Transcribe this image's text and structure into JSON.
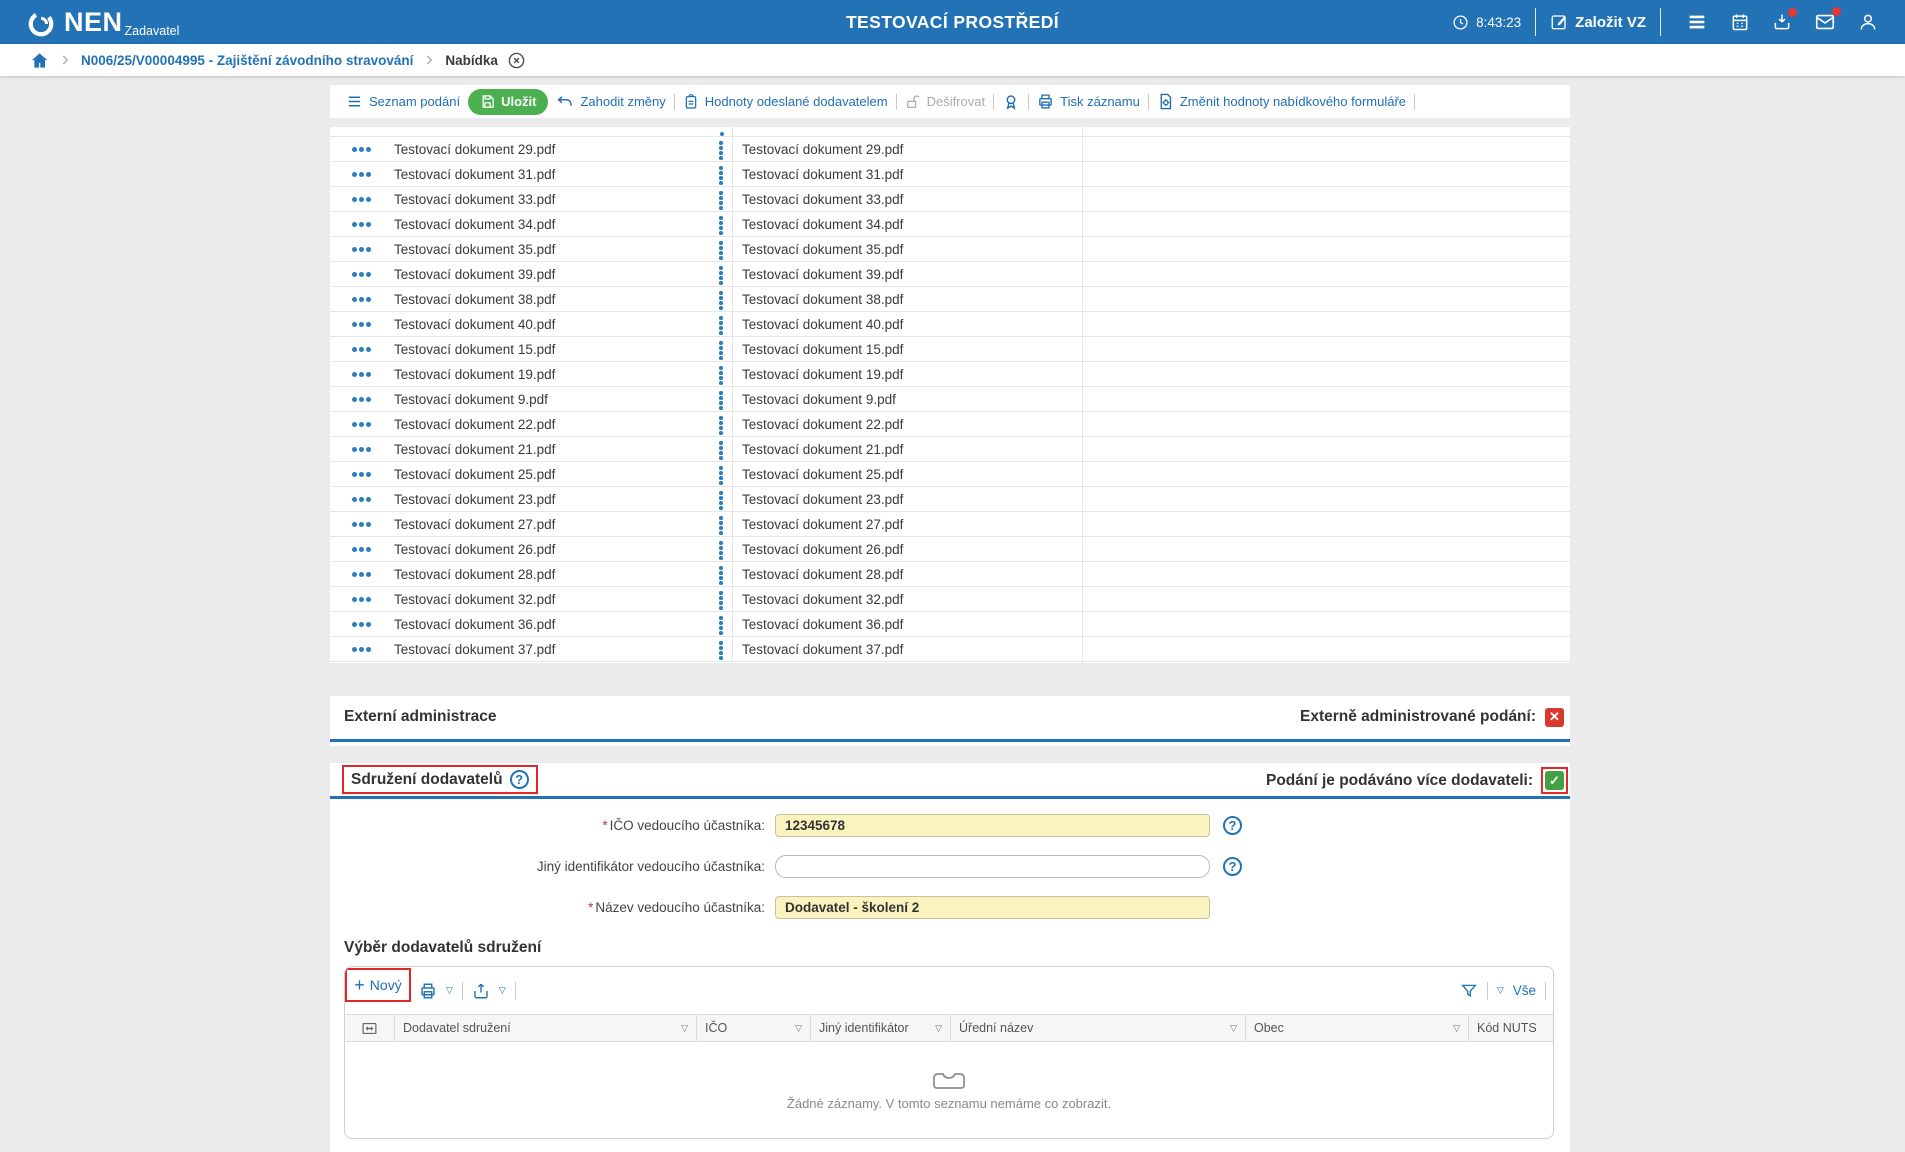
{
  "header": {
    "brand": "NEN",
    "brand_sub": "Zadavatel",
    "env_title": "TESTOVACÍ PROSTŘEDÍ",
    "time": "8:43:23",
    "create_vz": "Založit VZ"
  },
  "breadcrumb": {
    "path1": "N006/25/V00004995 - Zajištění závodního stravování",
    "path2": "Nabídka"
  },
  "toolbar": {
    "seznam_podani": "Seznam podání",
    "ulozit": "Uložit",
    "zahodit_zmeny": "Zahodit změny",
    "hodnoty_odeslane": "Hodnoty odeslané dodavatelem",
    "desifrovat": "Dešifrovat",
    "tisk_zaznamu": "Tisk záznamu",
    "zmenit_hodnoty": "Změnit hodnoty nabídkového formuláře"
  },
  "documents": {
    "rows": [
      "Testovací dokument 29.pdf",
      "Testovací dokument 31.pdf",
      "Testovací dokument 33.pdf",
      "Testovací dokument 34.pdf",
      "Testovací dokument 35.pdf",
      "Testovací dokument 39.pdf",
      "Testovací dokument 38.pdf",
      "Testovací dokument 40.pdf",
      "Testovací dokument 15.pdf",
      "Testovací dokument 19.pdf",
      "Testovací dokument 9.pdf",
      "Testovací dokument 22.pdf",
      "Testovací dokument 21.pdf",
      "Testovací dokument 25.pdf",
      "Testovací dokument 23.pdf",
      "Testovací dokument 27.pdf",
      "Testovací dokument 26.pdf",
      "Testovací dokument 28.pdf",
      "Testovací dokument 32.pdf",
      "Testovací dokument 36.pdf",
      "Testovací dokument 37.pdf"
    ]
  },
  "externi_administrace": {
    "title": "Externí administrace",
    "checkbox_label": "Externě administrované podání:",
    "checked": false
  },
  "sdruzeni_dodavatelu": {
    "title": "Sdružení dodavatelů",
    "checkbox_label": "Podání je podáváno více dodavateli:",
    "checked": true,
    "fields": [
      {
        "label": "IČO vedoucího účastníka:",
        "value": "12345678",
        "required": true
      },
      {
        "label": "Jiný identifikátor vedoucího účastníka:",
        "value": "",
        "required": false
      },
      {
        "label": "Název vedoucího účastníka:",
        "value": "Dodavatel - školení 2",
        "required": true
      }
    ]
  },
  "vyber_dodavatelu": {
    "title": "Výběr dodavatelů sdružení",
    "new_button": "Nový",
    "filter_all": "Vše",
    "columns": [
      "Dodavatel sdružení",
      "IČO",
      "Jiný identifikátor",
      "Úřední název",
      "Obec",
      "Kód NUTS"
    ],
    "empty_message": "Žádné záznamy. V tomto seznamu nemáme co zobrazit."
  },
  "icons": {
    "help": "?",
    "dropdown": "▽",
    "plus": "+",
    "check": "✓",
    "cross": "✕",
    "asterisk": "*"
  },
  "colors": {
    "primary_blue": "#2272b5",
    "section_line_blue": "#2071b5",
    "accent_green": "#4caf50",
    "required_yellow": "#faf3c0",
    "annotation_red": "#e32726",
    "checkbox_red": "#d8382e",
    "checkbox_green": "#43a047"
  }
}
